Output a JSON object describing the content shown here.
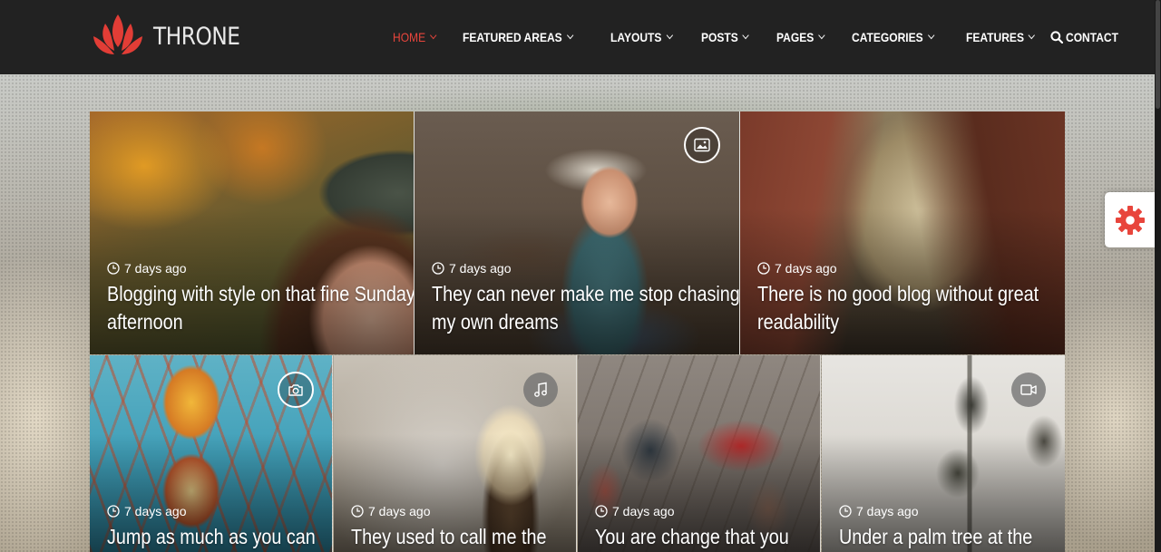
{
  "site": {
    "logo_text": "THRONE",
    "accent_color": "#e8453c",
    "header_bg": "#222222"
  },
  "nav": {
    "items": [
      {
        "label": "HOME",
        "has_dropdown": true,
        "active": true
      },
      {
        "label": "FEATURED AREAS",
        "has_dropdown": true,
        "active": false
      },
      {
        "label": "LAYOUTS",
        "has_dropdown": true,
        "active": false
      },
      {
        "label": "POSTS",
        "has_dropdown": true,
        "active": false
      },
      {
        "label": "PAGES",
        "has_dropdown": true,
        "active": false
      },
      {
        "label": "CATEGORIES",
        "has_dropdown": true,
        "active": false
      },
      {
        "label": "FEATURES",
        "has_dropdown": true,
        "active": false
      },
      {
        "label": "CONTACT",
        "has_dropdown": false,
        "active": false
      }
    ],
    "search_icon": "search-icon"
  },
  "posts": [
    {
      "date": "7 days ago",
      "title": "Blogging with style on that fine Sunday afternoon",
      "format_icon": null
    },
    {
      "date": "7 days ago",
      "title": "They can never make me stop chasing my own dreams",
      "format_icon": "image-icon"
    },
    {
      "date": "7 days ago",
      "title": "There is no good blog without great readability",
      "format_icon": null
    },
    {
      "date": "7 days ago",
      "title": "Jump as much as you can",
      "format_icon": "camera-icon"
    },
    {
      "date": "7 days ago",
      "title": "They used to call me the",
      "format_icon": "music-icon"
    },
    {
      "date": "7 days ago",
      "title": "You are change that you",
      "format_icon": null
    },
    {
      "date": "7 days ago",
      "title": "Under a palm tree at the",
      "format_icon": "video-icon"
    }
  ],
  "settings_panel": {
    "icon": "gear-icon",
    "icon_color": "#e8453c"
  }
}
